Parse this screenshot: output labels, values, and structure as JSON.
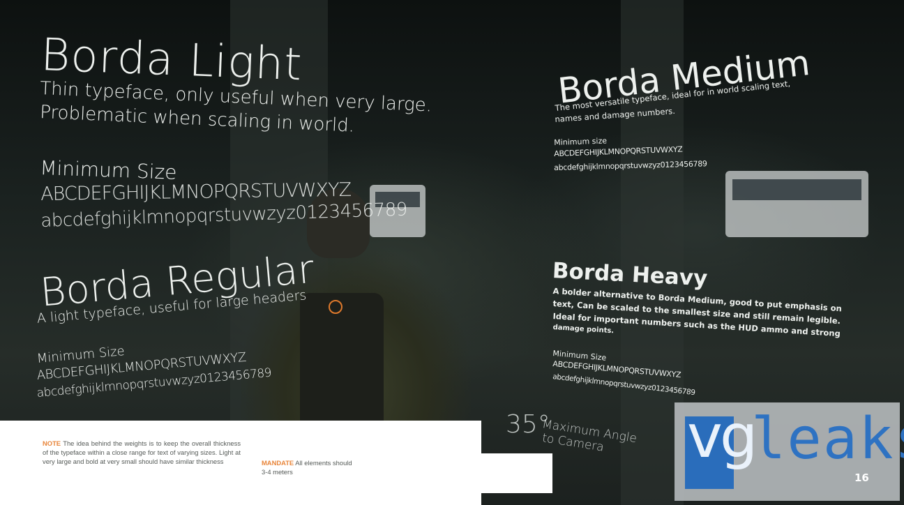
{
  "borda_light": {
    "title": "Borda Light",
    "desc_line1": "Thin typeface, only useful when very large.",
    "desc_line2": "Problematic when scaling in world.",
    "min_size_label": "Minimum Size",
    "uppercase": "ABCDEFGHIJKLMNOPQRSTUVWXYZ",
    "lowercase": "abcdefghijklmnopqrstuvwzyz0123456789"
  },
  "borda_regular": {
    "title": "Borda Regular",
    "desc": "A light typeface, useful for large headers",
    "min_size_label": "Minimum Size",
    "uppercase": "ABCDEFGHIJKLMNOPQRSTUVWXYZ",
    "lowercase": "abcdefghijklmnopqrstuvwzyz0123456789"
  },
  "borda_medium": {
    "title": "Borda Medium",
    "desc_line1": "The most versatile typeface, ideal for in world scaling text,",
    "desc_line2": "names and damage numbers.",
    "min_size_label": "Minimum size",
    "uppercase": "ABCDEFGHIJKLMNOPQRSTUVWXYZ",
    "lowercase": "abcdefghijklmnopqrstuvwzyz0123456789"
  },
  "borda_heavy": {
    "title": "Borda Heavy",
    "desc_line1": "A bolder alternative to Borda Medium, good to put emphasis on",
    "desc_line2": "text, Can be scaled to the smallest size and still remain legible.",
    "desc_line3": "Ideal for important numbers such as the HUD ammo and strong",
    "desc_line4": "damage points.",
    "min_size_label": "Minimum Size",
    "uppercase": "ABCDEFGHIJKLMNOPQRSTUVWXYZ",
    "lowercase": "abcdefghijklmnopqrstuvwzyz0123456789"
  },
  "max_angle": {
    "degrees": "35°",
    "line1": "Maximum Angle",
    "line2": "to Camera"
  },
  "note": {
    "label": "NOTE",
    "text": "The idea behind the weights is to keep the overall thickness of the typeface within a close range for text of varying sizes. Light at very large and bold at very small should have similar thickness"
  },
  "mandate": {
    "label": "MANDATE",
    "text_line1": "All elements should",
    "text_line2": "3-4 meters"
  },
  "watermark": {
    "brand_vg": "vg",
    "brand_leaks": "leaks",
    "page_number": "16"
  },
  "colors": {
    "note_accent": "#e8853a",
    "logo_blue": "#2a6dbb",
    "marker_orange": "#e07a2c"
  }
}
